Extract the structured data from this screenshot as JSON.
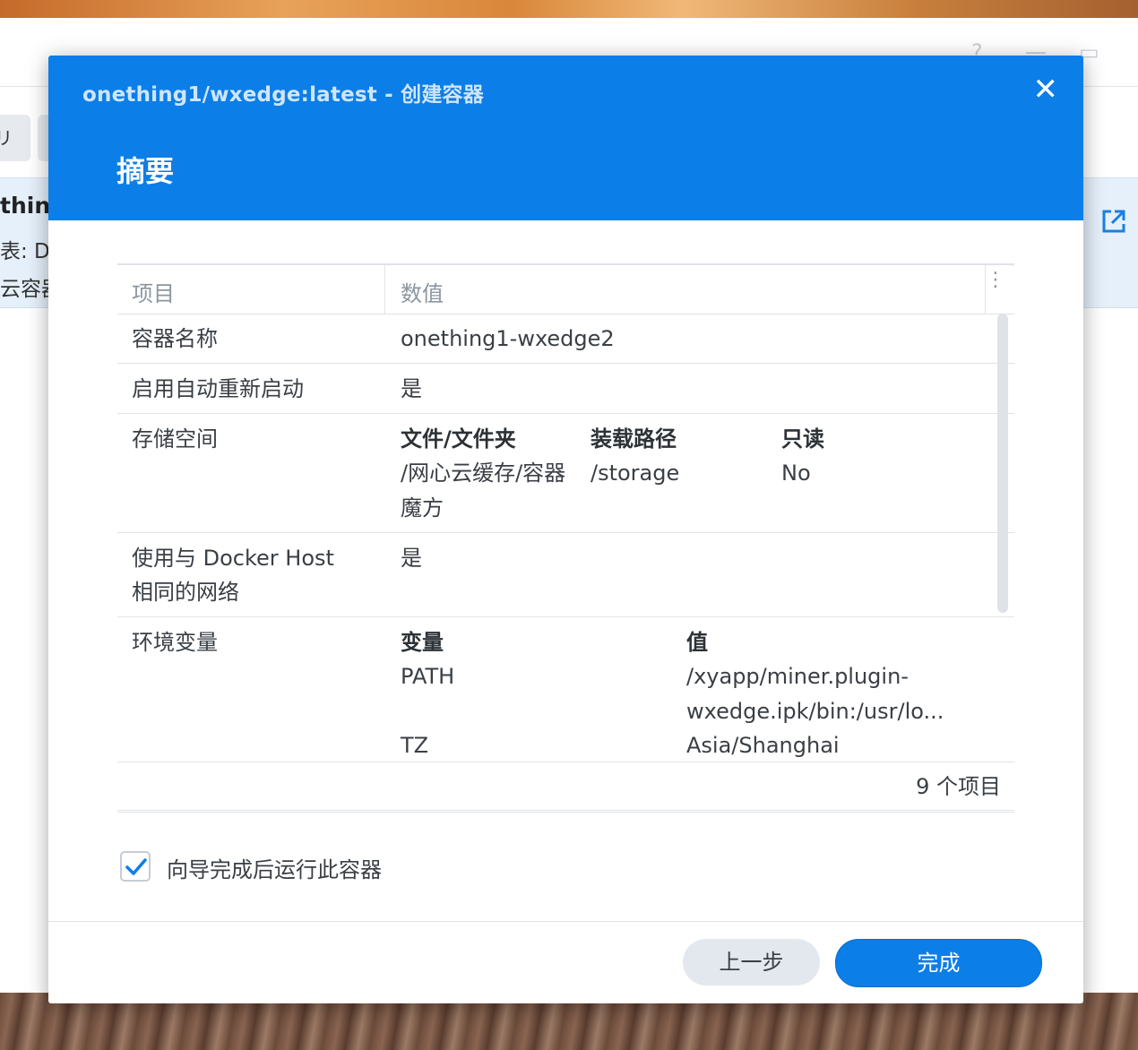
{
  "dialog": {
    "title": "onething1/wxedge:latest - 创建容器",
    "close_glyph": "✕",
    "heading": "摘要"
  },
  "background": {
    "toolbar_fragment": "hing",
    "row_title_fragment": "thing",
    "row_line2_fragment": "表: D",
    "row_line3_fragment": "云容器",
    "left_btn_fragment": "リ"
  },
  "table": {
    "header": {
      "key": "项目",
      "value": "数值"
    },
    "rows": {
      "name": {
        "key": "容器名称",
        "value": "onething1-wxedge2"
      },
      "restart": {
        "key": "启用自动重新启动",
        "value": "是"
      },
      "storage": {
        "key": "存储空间",
        "h_file": "文件/文件夹",
        "h_mount": "装载路径",
        "h_ro": "只读",
        "file_line1": "/网心云缓存/容器",
        "file_line2": "魔方",
        "mount": "/storage",
        "ro": "No"
      },
      "network": {
        "key_line1": "使用与 Docker Host",
        "key_line2": "相同的网络",
        "value": "是"
      },
      "env": {
        "key": "环境变量",
        "h_var": "变量",
        "h_val": "值",
        "var1": "PATH",
        "val1_line1": "/xyapp/miner.plugin-",
        "val1_line2": "wxedge.ipk/bin:/usr/lo...",
        "var2": "TZ",
        "val2": "Asia/Shanghai"
      }
    },
    "count": "9 个项目"
  },
  "options": {
    "run_after": "向导完成后运行此容器",
    "run_after_checked": true
  },
  "buttons": {
    "back": "上一步",
    "done": "完成"
  },
  "colors": {
    "accent": "#0b7ee8"
  }
}
